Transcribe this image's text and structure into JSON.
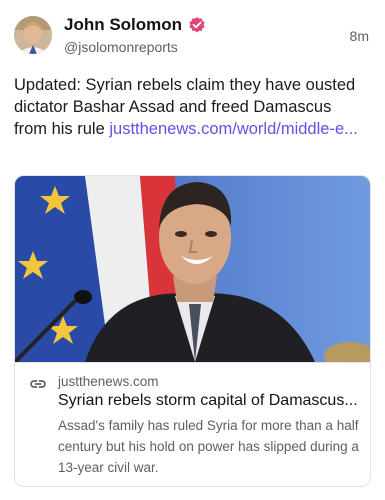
{
  "post": {
    "author_name": "John Solomon",
    "author_handle": "@jsolomonreports",
    "timestamp": "8m",
    "text": "Updated: Syrian rebels claim they have ousted dictator Bashar Assad and freed Damascus from his rule ",
    "link_text": "justthenews.com/world/middle-e...",
    "verified_icon": "verified-badge-icon",
    "accent_color": "#6b4de6"
  },
  "link_card": {
    "domain": "justthenews.com",
    "title": "Syrian rebels storm capital of Damascus...",
    "description": "Assad's family has ruled Syria for more than a half century but his hold on power has slipped during a 13-year civil war.",
    "icon": "link-icon"
  }
}
